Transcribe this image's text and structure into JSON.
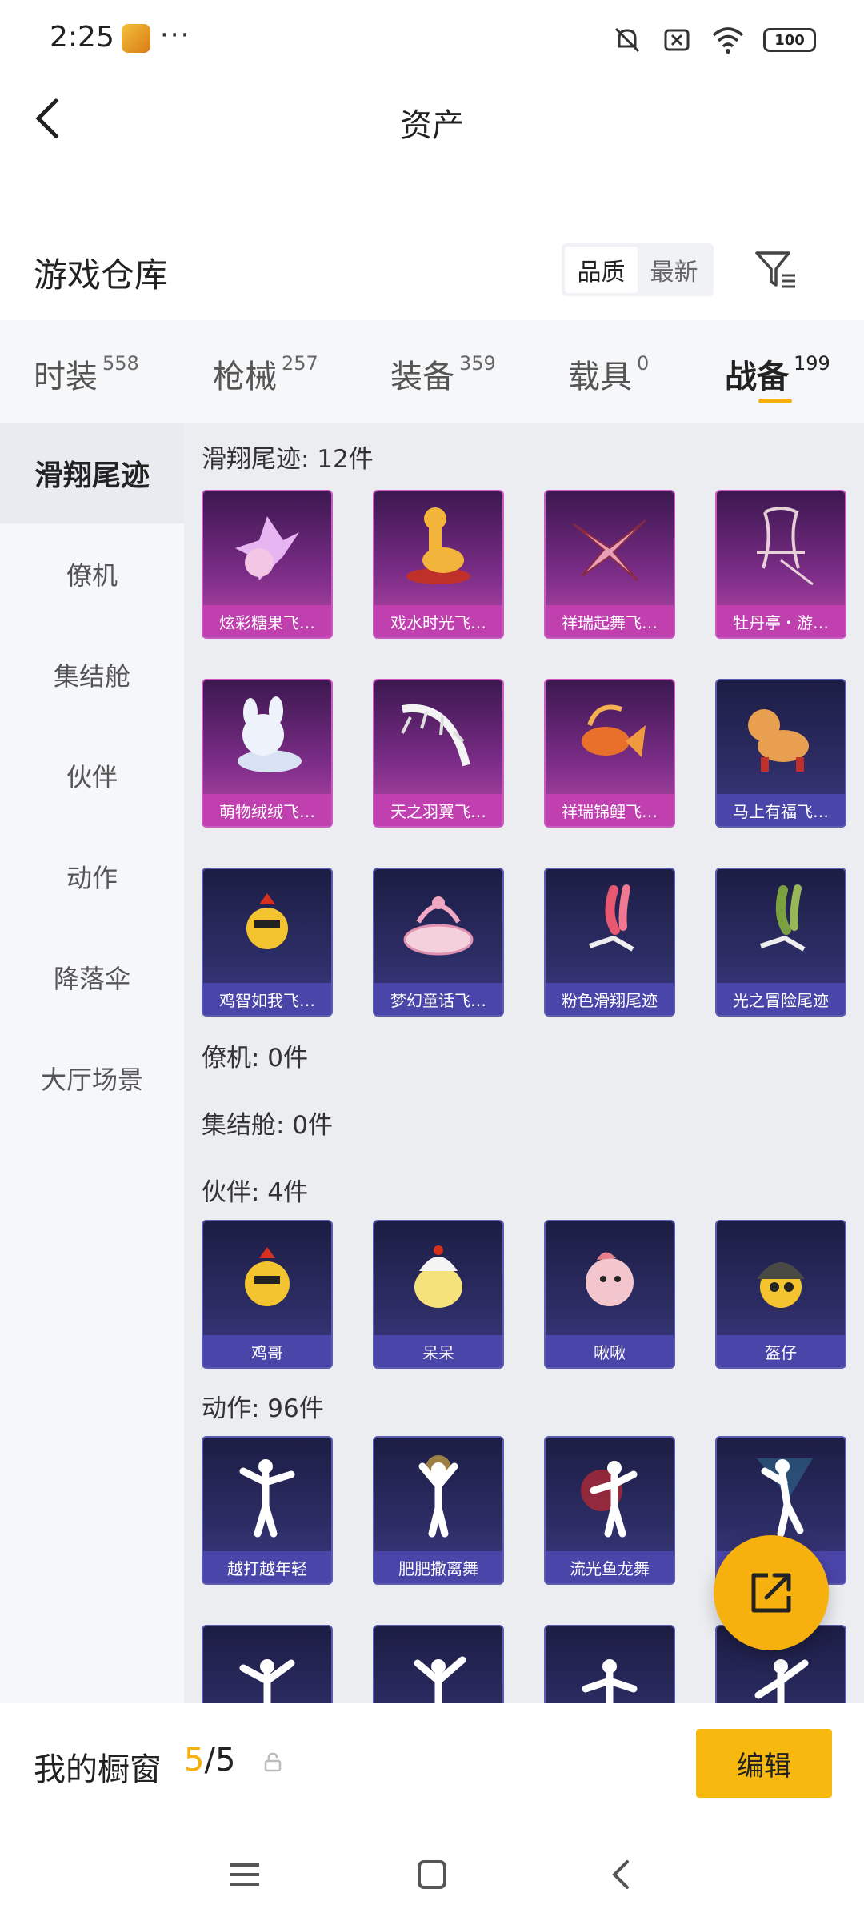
{
  "status_bar": {
    "time": "2:25",
    "dots": "···",
    "battery": "100"
  },
  "header": {
    "title": "资产"
  },
  "section": {
    "title": "游戏仓库",
    "sort": [
      "品质",
      "最新"
    ]
  },
  "tabs": [
    {
      "label": "时装",
      "count": "558"
    },
    {
      "label": "枪械",
      "count": "257"
    },
    {
      "label": "装备",
      "count": "359"
    },
    {
      "label": "载具",
      "count": "0"
    },
    {
      "label": "战备",
      "count": "199"
    }
  ],
  "sidebar": [
    "滑翔尾迹",
    "僚机",
    "集结舱",
    "伙伴",
    "动作",
    "降落伞",
    "大厅场景"
  ],
  "groups": {
    "glide": {
      "title": "滑翔尾迹: 12件",
      "items": [
        "炫彩糖果飞…",
        "戏水时光飞…",
        "祥瑞起舞飞…",
        "牡丹亭・游…",
        "萌物绒绒飞…",
        "天之羽翼飞…",
        "祥瑞锦鲤飞…",
        "马上有福飞…",
        "鸡智如我飞…",
        "梦幻童话飞…",
        "粉色滑翔尾迹",
        "光之冒险尾迹"
      ]
    },
    "wingman": {
      "title": "僚机: 0件"
    },
    "pod": {
      "title": "集结舱: 0件"
    },
    "partner": {
      "title": "伙伴: 4件",
      "items": [
        "鸡哥",
        "呆呆",
        "啾啾",
        "盔仔"
      ]
    },
    "emote": {
      "title": "动作: 96件",
      "items": [
        "越打越年轻",
        "肥肥撒离舞",
        "流光鱼龙舞",
        ""
      ]
    }
  },
  "showcase": {
    "title": "我的橱窗",
    "current": "5",
    "total": "5",
    "edit_label": "编辑"
  },
  "colors": {
    "accent": "#f5b00c",
    "purple_card": "#c040b0",
    "blue_card": "#4a45a8"
  }
}
